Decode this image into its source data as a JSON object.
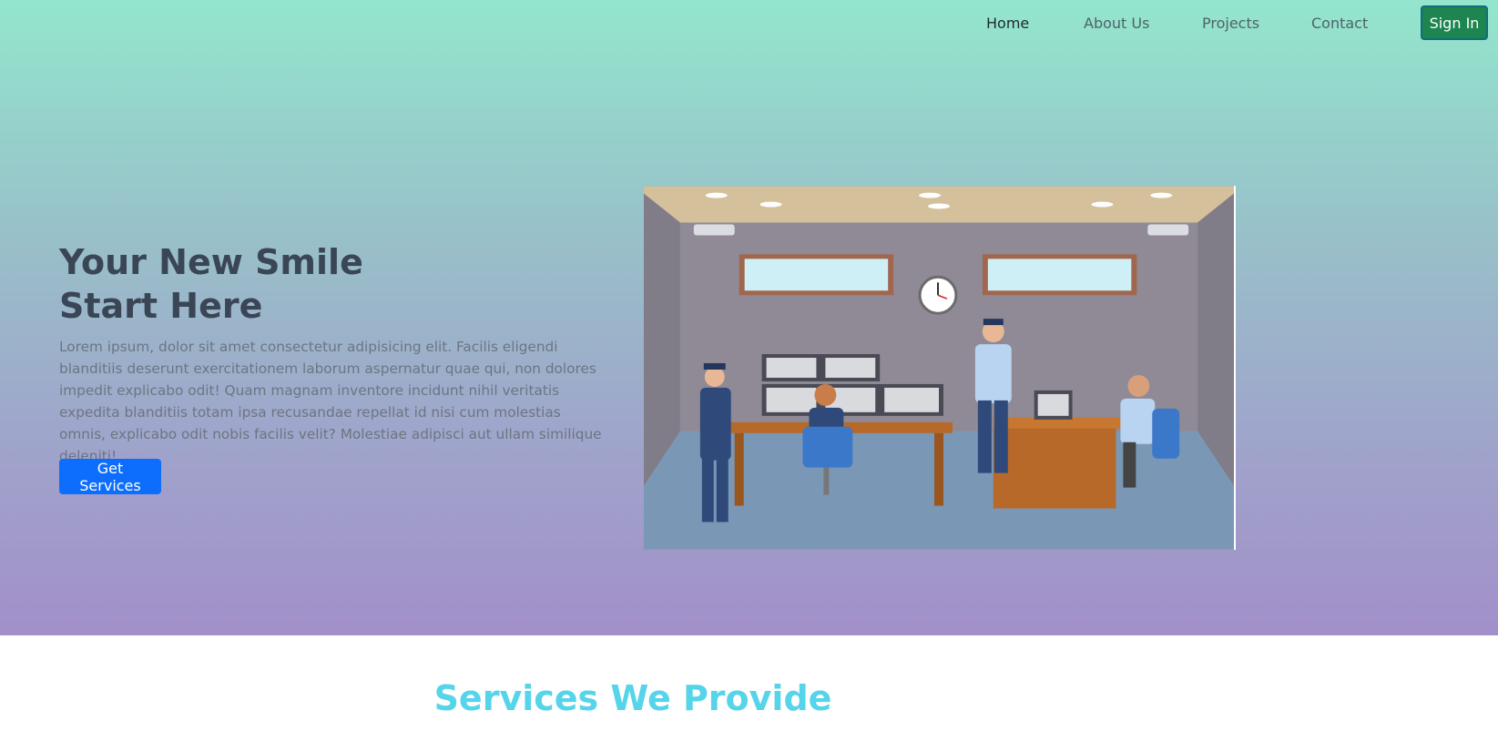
{
  "nav": {
    "links": [
      "Home",
      "About Us",
      "Projects",
      "Contact"
    ],
    "signin_label": "Sign In"
  },
  "hero": {
    "headline_line1": "Your New Smile",
    "headline_line2": "Start Here",
    "body": "Lorem ipsum, dolor sit amet consectetur adipisicing elit. Facilis eligendi blanditiis deserunt exercitationem laborum aspernatur quae qui, non dolores impedit explicabo odit! Quam magnam inventore incidunt nihil veritatis expedita blanditiis totam ipsa recusandae repellat id nisi cum molestias omnis, explicabo odit nobis facilis velit? Molestiae adipisci aut ullam similique deleniti!",
    "cta_label": "Get Services"
  },
  "services": {
    "title": "Services We Provide"
  },
  "colors": {
    "gradient_top": "#93e6cd",
    "gradient_bottom": "#a38fca",
    "cta": "#0d6efd",
    "signin": "#1c8550",
    "section_title": "#56d4e9"
  }
}
